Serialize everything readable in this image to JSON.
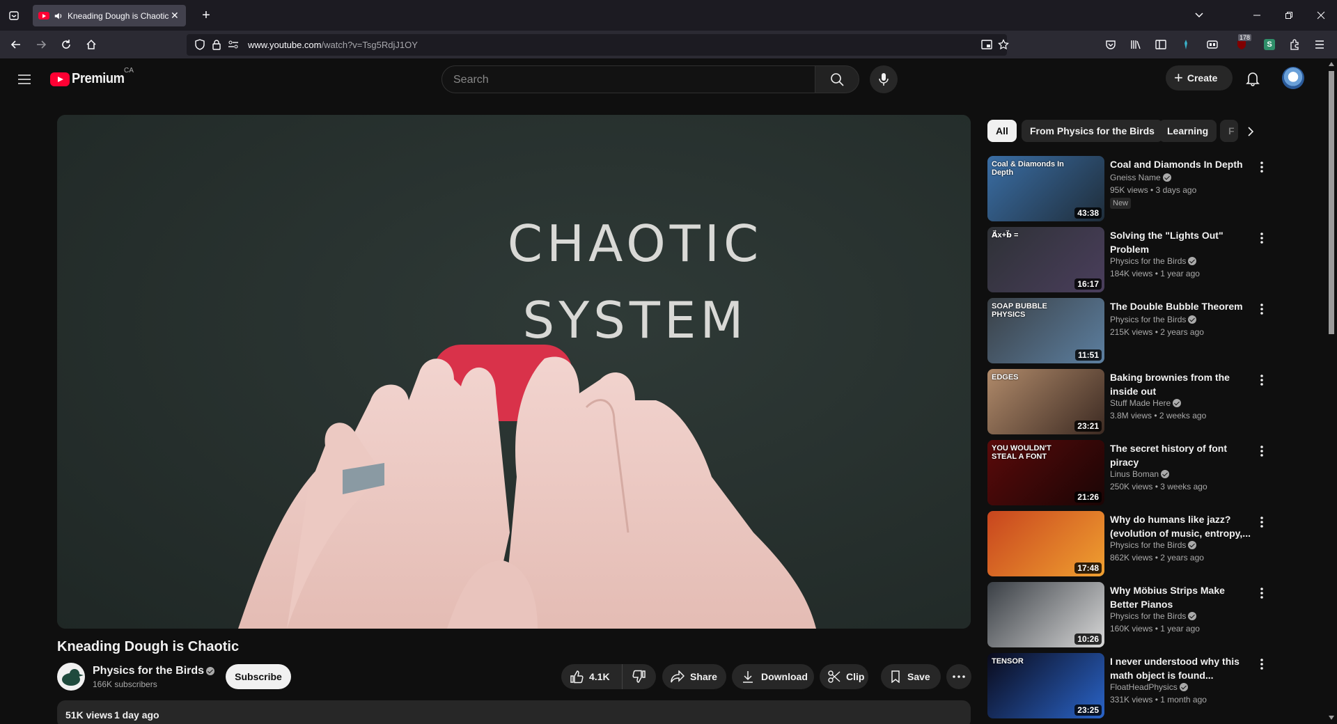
{
  "browser": {
    "tab_title": "Kneading Dough is Chaotic",
    "url_host": "www.youtube.com",
    "url_path": "/watch?v=Tsg5RdjJ1OY",
    "extension_badge": "178"
  },
  "masthead": {
    "logo_text": "Premium",
    "country_code": "CA",
    "search_placeholder": "Search",
    "create_label": "Create"
  },
  "player": {
    "overlay_line1": "CHAOTIC",
    "overlay_line2": "SYSTEM"
  },
  "video": {
    "title": "Kneading Dough is Chaotic",
    "channel": "Physics for the Birds",
    "subscribers": "166K subscribers",
    "subscribe_label": "Subscribe",
    "likes": "4.1K",
    "share_label": "Share",
    "download_label": "Download",
    "clip_label": "Clip",
    "save_label": "Save",
    "views": "51K views",
    "age": "1 day ago"
  },
  "chips": [
    "All",
    "From Physics for the Birds",
    "Learning",
    "F"
  ],
  "recommendations": [
    {
      "title": "Coal and Diamonds In Depth",
      "channel": "Gneiss Name",
      "meta": "95K views • 3 days ago",
      "duration": "43:38",
      "badge": "New",
      "thumb_text": "Coal & Diamonds In Depth",
      "colors": [
        "#3a6ea5",
        "#1f2d3a"
      ]
    },
    {
      "title": "Solving the \"Lights Out\" Problem",
      "channel": "Physics for the Birds",
      "meta": "184K views • 1 year ago",
      "duration": "16:17",
      "badge": "",
      "thumb_text": "A⃗x+b⃗ =",
      "colors": [
        "#2e3136",
        "#4a3e5c"
      ]
    },
    {
      "title": "The Double Bubble Theorem",
      "channel": "Physics for the Birds",
      "meta": "215K views • 2 years ago",
      "duration": "11:51",
      "badge": "",
      "thumb_text": "SOAP BUBBLE PHYSICS",
      "colors": [
        "#3a4046",
        "#5c7fa0"
      ]
    },
    {
      "title": "Baking brownies from the inside out",
      "channel": "Stuff Made Here",
      "meta": "3.8M views • 2 weeks ago",
      "duration": "23:21",
      "badge": "",
      "thumb_text": "EDGES",
      "colors": [
        "#b08a6a",
        "#3c2a22"
      ]
    },
    {
      "title": "The secret history of font piracy",
      "channel": "Linus Boman",
      "meta": "250K views • 3 weeks ago",
      "duration": "21:26",
      "badge": "",
      "thumb_text": "YOU WOULDN'T STEAL A FONT",
      "colors": [
        "#5a0a0a",
        "#1a0505"
      ]
    },
    {
      "title": "Why do humans like jazz? (evolution of music, entropy,...",
      "channel": "Physics for the Birds",
      "meta": "862K views • 2 years ago",
      "duration": "17:48",
      "badge": "",
      "thumb_text": "",
      "colors": [
        "#c8451e",
        "#f0a030"
      ]
    },
    {
      "title": "Why Möbius Strips Make Better Pianos",
      "channel": "Physics for the Birds",
      "meta": "160K views • 1 year ago",
      "duration": "10:26",
      "badge": "",
      "thumb_text": "",
      "colors": [
        "#3a3f45",
        "#d8d8d8"
      ]
    },
    {
      "title": "I never understood why this math object is found...",
      "channel": "FloatHeadPhysics",
      "meta": "331K views • 1 month ago",
      "duration": "23:25",
      "badge": "",
      "thumb_text": "TENSOR",
      "colors": [
        "#0a0a1a",
        "#2a64c8"
      ]
    }
  ]
}
